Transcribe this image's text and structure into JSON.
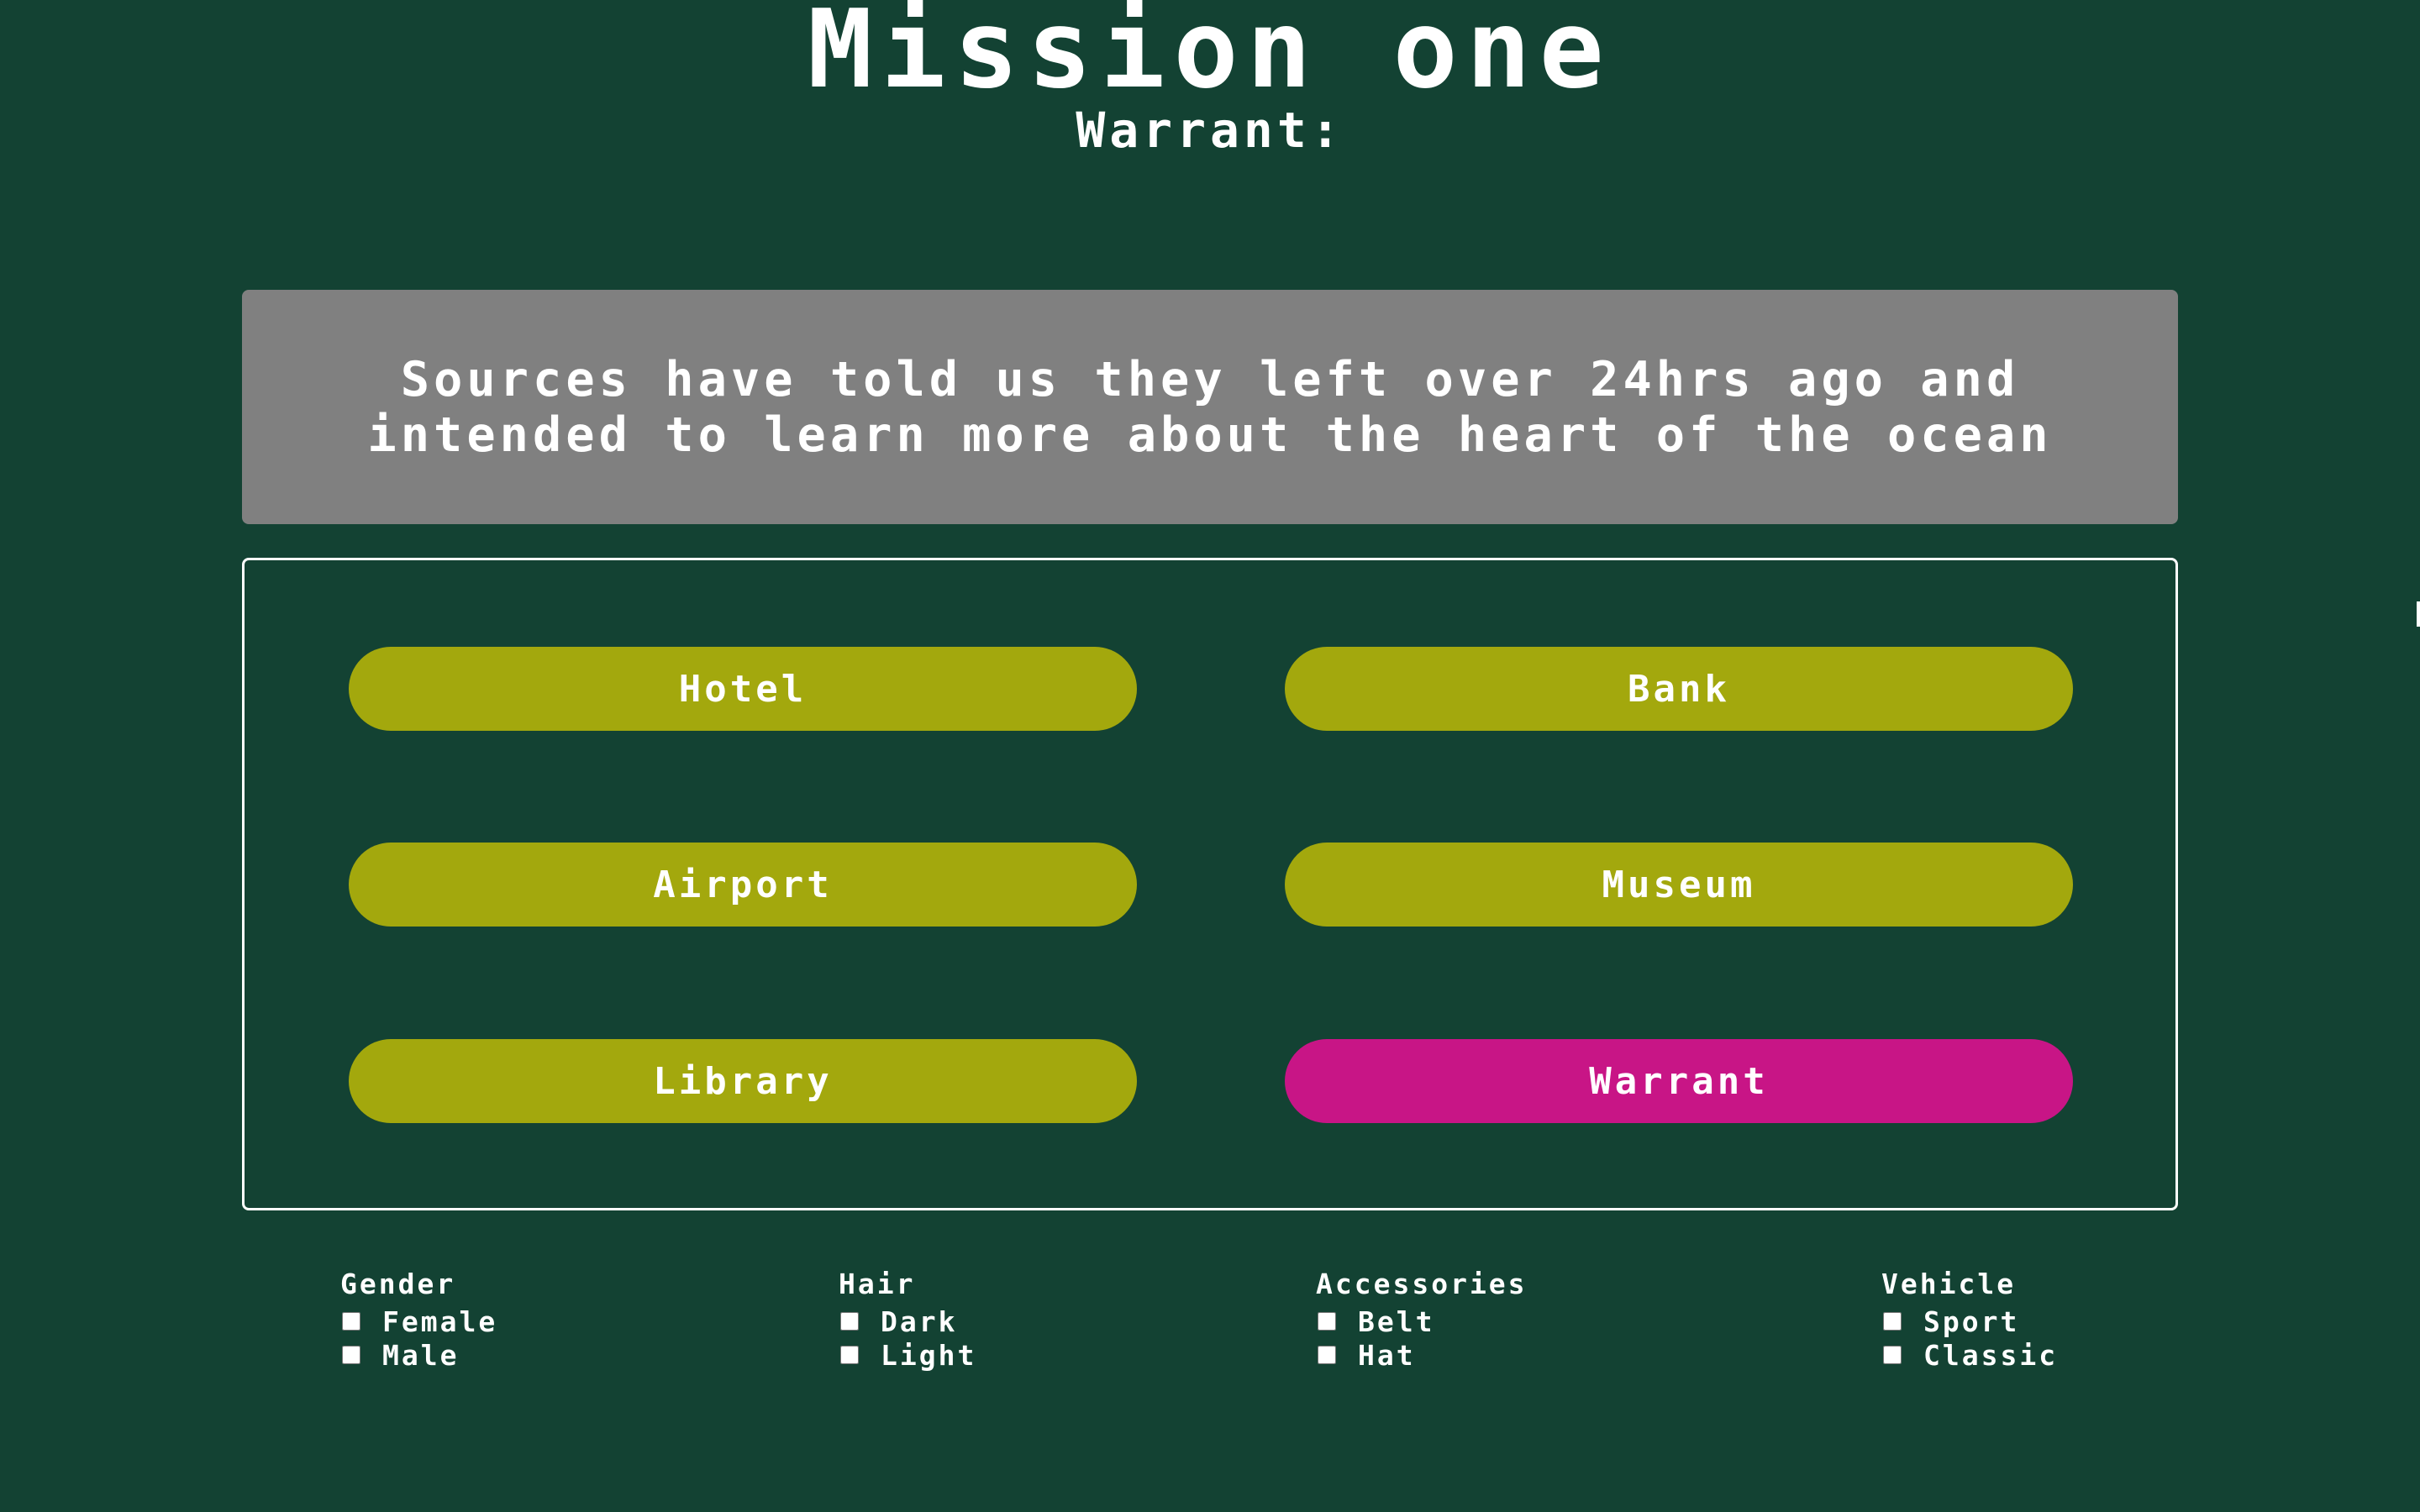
{
  "header": {
    "title": "Mission one",
    "subtitle": "Warrant:"
  },
  "clue": {
    "text": "Sources have told us they left over 24hrs ago and intended to learn more about the heart of the ocean"
  },
  "locations": {
    "hotel": "Hotel",
    "bank": "Bank",
    "airport": "Airport",
    "museum": "Museum",
    "library": "Library",
    "warrant": "Warrant"
  },
  "filters": {
    "gender": {
      "title": "Gender",
      "options": [
        "Female",
        "Male"
      ]
    },
    "hair": {
      "title": "Hair",
      "options": [
        "Dark",
        "Light"
      ]
    },
    "accessories": {
      "title": "Accessories",
      "options": [
        "Belt",
        "Hat"
      ]
    },
    "vehicle": {
      "title": "Vehicle",
      "options": [
        "Sport",
        "Classic"
      ]
    }
  },
  "colors": {
    "background": "#134233",
    "clue_box": "#808080",
    "location_button": "#a3a80d",
    "active_button": "#c81586",
    "text": "#ffffff"
  }
}
